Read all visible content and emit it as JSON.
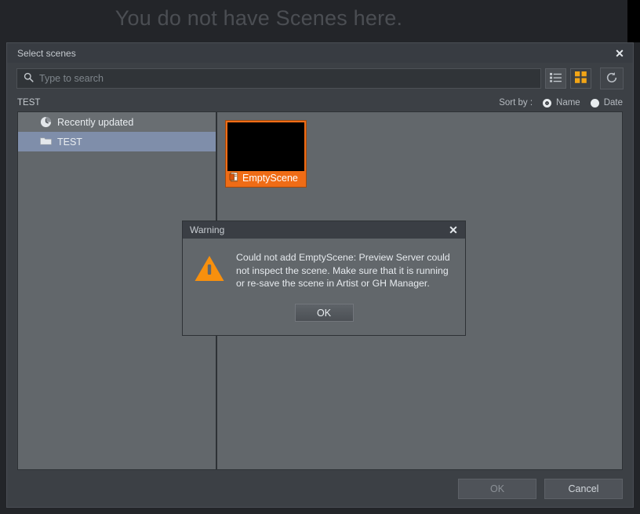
{
  "background": {
    "empty_message": "You do not have Scenes here."
  },
  "dialog": {
    "title": "Select scenes",
    "close_label": "✕",
    "search": {
      "placeholder": "Type to search",
      "icon": "search-icon"
    },
    "view_modes": [
      {
        "name": "list-view",
        "icon": "list-view-icon",
        "active": false
      },
      {
        "name": "grid-view",
        "icon": "grid-view-icon",
        "active": true
      }
    ],
    "refresh": {
      "icon": "refresh-icon",
      "tooltip": "Refresh"
    },
    "breadcrumb": "TEST",
    "sort": {
      "label": "Sort by :",
      "options": [
        {
          "label": "Name",
          "style": "ring"
        },
        {
          "label": "Date",
          "style": "filled"
        }
      ]
    },
    "tree": {
      "items": [
        {
          "label": "Recently updated",
          "icon": "clock-icon",
          "selected": false
        },
        {
          "label": "TEST",
          "icon": "folder-icon",
          "selected": true
        }
      ]
    },
    "scenes": [
      {
        "label": "EmptyScene",
        "icon": "scene-file-icon",
        "selected": true
      }
    ],
    "footer": {
      "ok_label": "OK",
      "cancel_label": "Cancel"
    }
  },
  "warning": {
    "title": "Warning",
    "close_label": "✕",
    "icon": "warning-triangle-icon",
    "message": "Could not add EmptyScene: Preview Server could not inspect the scene. Make sure that it is running or re-save the scene in Artist or GH Manager.",
    "ok_label": "OK"
  },
  "colors": {
    "accent_orange": "#ef6c16",
    "warning_orange": "#f8900d",
    "selection_blue": "#7f8eaa",
    "panel_gray": "#62676b",
    "chrome_dark": "#3c4045"
  }
}
